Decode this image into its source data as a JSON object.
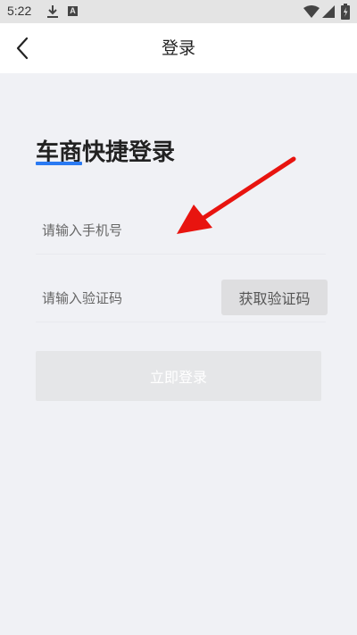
{
  "status_bar": {
    "time": "5:22",
    "badge_letter": "A",
    "icons": [
      "download-icon",
      "text-badge-icon",
      "wifi-icon",
      "signal-icon",
      "battery-icon"
    ]
  },
  "nav": {
    "title": "登录",
    "back_icon": "chevron-left-icon"
  },
  "login": {
    "heading": "车商快捷登录",
    "phone_placeholder": "请输入手机号",
    "code_placeholder": "请输入验证码",
    "get_code_label": "获取验证码",
    "submit_label": "立即登录"
  },
  "colors": {
    "accent": "#2a7af2",
    "annotation_arrow": "#e8140f",
    "page_background": "#f0f1f5"
  }
}
